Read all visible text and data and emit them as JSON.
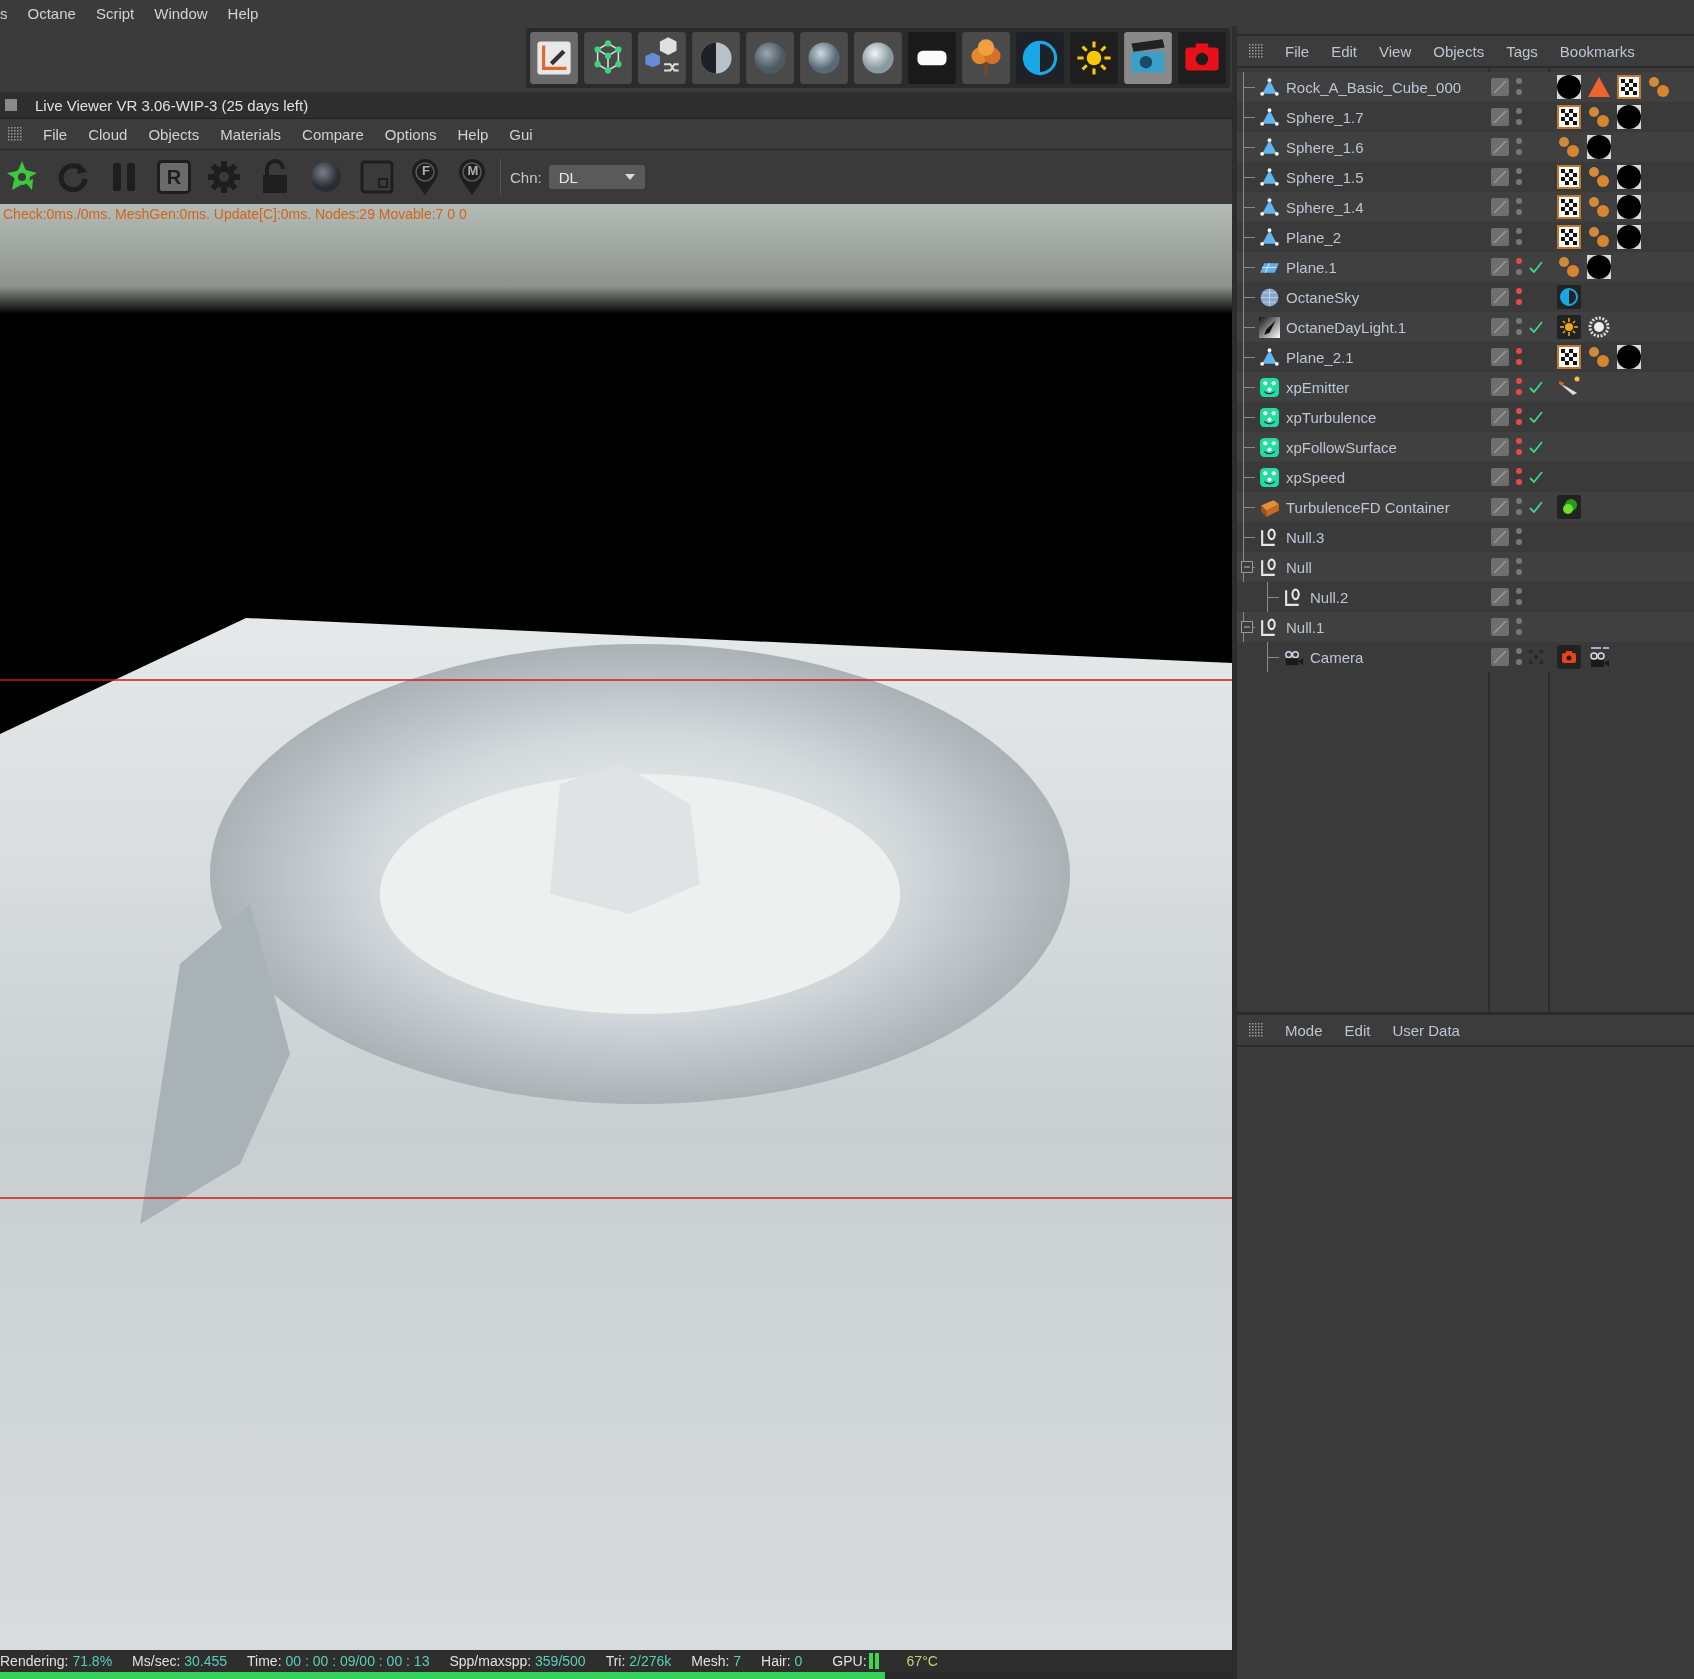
{
  "menu_bar": {
    "items": [
      "s",
      "Octane",
      "Script",
      "Window",
      "Help"
    ]
  },
  "live_viewer": {
    "title": "Live Viewer VR 3.06-WIP-3 (25 days left)",
    "menu": [
      "File",
      "Cloud",
      "Objects",
      "Materials",
      "Compare",
      "Options",
      "Help",
      "Gui"
    ],
    "toolbar_letters": [
      "R",
      "F",
      "M"
    ],
    "channel": {
      "label": "Chn:",
      "value": "DL"
    },
    "message": "Check:0ms./0ms. MeshGen:0ms. Update[C]:0ms. Nodes:29 Movable:7  0 0",
    "status_bar": {
      "items": [
        {
          "kind": "text",
          "label": "Rendering:",
          "value": "71.8%"
        },
        {
          "kind": "text",
          "label": "Ms/sec:",
          "value": "30.455"
        },
        {
          "kind": "text",
          "label": "Time:",
          "value": "00 : 00 : 09/00 : 00 : 13"
        },
        {
          "kind": "text",
          "label": "Spp/maxspp:",
          "value": "359/500"
        },
        {
          "kind": "text",
          "label": "Tri:",
          "value": "2/276k"
        },
        {
          "kind": "text",
          "label": "Mesh:",
          "value": "7"
        },
        {
          "kind": "text",
          "label": "Hair:",
          "value": "0"
        },
        {
          "kind": "gpu",
          "label": "GPU:"
        }
      ],
      "temperature": "67°C"
    },
    "progress": {
      "level": 0.718
    }
  },
  "object_manager": {
    "menu": [
      "File",
      "Edit",
      "View",
      "Objects",
      "Tags",
      "Bookmarks"
    ],
    "objects": [
      {
        "name": "Rock_A_Basic_Cube_000",
        "kind": "polygon",
        "editor_on": false,
        "render_on": false,
        "tags": [
          {
            "kind": "material"
          },
          {
            "kind": "triangle"
          },
          {
            "kind": "checker"
          },
          {
            "kind": "phong"
          }
        ]
      },
      {
        "name": "Sphere_1.7",
        "kind": "polygon",
        "editor_on": false,
        "render_on": false,
        "tags": [
          {
            "kind": "checker"
          },
          {
            "kind": "phong"
          },
          {
            "kind": "material"
          }
        ]
      },
      {
        "name": "Sphere_1.6",
        "kind": "polygon",
        "editor_on": false,
        "render_on": false,
        "tags": [
          {
            "kind": "phong"
          },
          {
            "kind": "material"
          }
        ]
      },
      {
        "name": "Sphere_1.5",
        "kind": "polygon",
        "editor_on": false,
        "render_on": false,
        "tags": [
          {
            "kind": "checker"
          },
          {
            "kind": "phong"
          },
          {
            "kind": "material"
          }
        ]
      },
      {
        "name": "Sphere_1.4",
        "kind": "polygon",
        "editor_on": false,
        "render_on": false,
        "tags": [
          {
            "kind": "checker"
          },
          {
            "kind": "phong"
          },
          {
            "kind": "material"
          }
        ]
      },
      {
        "name": "Plane_2",
        "kind": "polygon",
        "editor_on": false,
        "render_on": false,
        "tags": [
          {
            "kind": "checker"
          },
          {
            "kind": "phong"
          },
          {
            "kind": "material"
          }
        ]
      },
      {
        "name": "Plane.1",
        "kind": "plane",
        "editor_on": true,
        "render_on": false,
        "checked": true,
        "tags": [
          {
            "kind": "phong"
          },
          {
            "kind": "material"
          }
        ]
      },
      {
        "name": "OctaneSky",
        "kind": "sky",
        "editor_on": true,
        "render_on": true,
        "tags": [
          {
            "kind": "sky"
          }
        ]
      },
      {
        "name": "OctaneDayLight.1",
        "kind": "daylight",
        "editor_on": false,
        "render_on": false,
        "checked": true,
        "tags": [
          {
            "kind": "sun"
          },
          {
            "kind": "ring"
          }
        ]
      },
      {
        "name": "Plane_2.1",
        "kind": "polygon",
        "editor_on": true,
        "render_on": true,
        "tags": [
          {
            "kind": "checker"
          },
          {
            "kind": "phong"
          },
          {
            "kind": "material"
          }
        ]
      },
      {
        "name": "xpEmitter",
        "kind": "xp",
        "editor_on": true,
        "render_on": true,
        "checked": true,
        "tags": [
          {
            "kind": "emitter"
          }
        ]
      },
      {
        "name": "xpTurbulence",
        "kind": "xp",
        "editor_on": true,
        "render_on": true,
        "checked": true
      },
      {
        "name": "xpFollowSurface",
        "kind": "xp",
        "editor_on": true,
        "render_on": true,
        "checked": true
      },
      {
        "name": "xpSpeed",
        "kind": "xp",
        "editor_on": true,
        "render_on": true,
        "checked": true
      },
      {
        "name": "TurbulenceFD Container",
        "kind": "fluid",
        "editor_on": false,
        "render_on": false,
        "checked": true,
        "tags": [
          {
            "kind": "fluid"
          }
        ]
      },
      {
        "name": "Null.3",
        "kind": "null",
        "editor_on": false,
        "render_on": false
      },
      {
        "name": "Null",
        "kind": "null",
        "editor_on": false,
        "render_on": false,
        "expanded": true,
        "children": [
          {
            "name": "Null.2",
            "kind": "null",
            "editor_on": false,
            "render_on": false
          }
        ]
      },
      {
        "name": "Null.1",
        "kind": "null",
        "editor_on": false,
        "render_on": false,
        "expanded": true,
        "children": [
          {
            "name": "Camera",
            "kind": "camera",
            "editor_on": false,
            "render_on": false,
            "targeted": true,
            "tags": [
              {
                "kind": "camera-red"
              },
              {
                "kind": "camera"
              }
            ]
          }
        ]
      }
    ]
  },
  "attribute_manager": {
    "menu": [
      "Mode",
      "Edit",
      "User Data"
    ]
  }
}
